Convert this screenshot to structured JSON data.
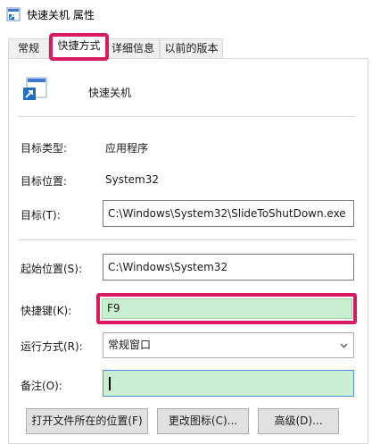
{
  "window": {
    "title": "快速关机 属性",
    "icon": "shortcut-properties-icon"
  },
  "tabs": [
    {
      "label": "常规"
    },
    {
      "label": "快捷方式"
    },
    {
      "label": "详细信息"
    },
    {
      "label": "以前的版本"
    }
  ],
  "shortcut": {
    "name": "快速关机",
    "icon": "shortcut-file-icon"
  },
  "target_type": {
    "label": "目标类型:",
    "value": "应用程序"
  },
  "target_location": {
    "label": "目标位置:",
    "value": "System32"
  },
  "target": {
    "label": "目标(T):",
    "value": "C:\\Windows\\System32\\SlideToShutDown.exe"
  },
  "start_in": {
    "label": "起始位置(S):",
    "value": "C:\\Windows\\System32"
  },
  "hotkey": {
    "label": "快捷键(K):",
    "value": "F9"
  },
  "run": {
    "label": "运行方式(R):",
    "value": "常规窗口"
  },
  "comment": {
    "label": "备注(O):",
    "value": ""
  },
  "buttons": {
    "open_location": "打开文件所在的位置(F)",
    "change_icon": "更改图标(C)...",
    "advanced": "高级(D)..."
  },
  "colors": {
    "highlight": "#d81b60",
    "field_green": "#c8f0d0"
  }
}
